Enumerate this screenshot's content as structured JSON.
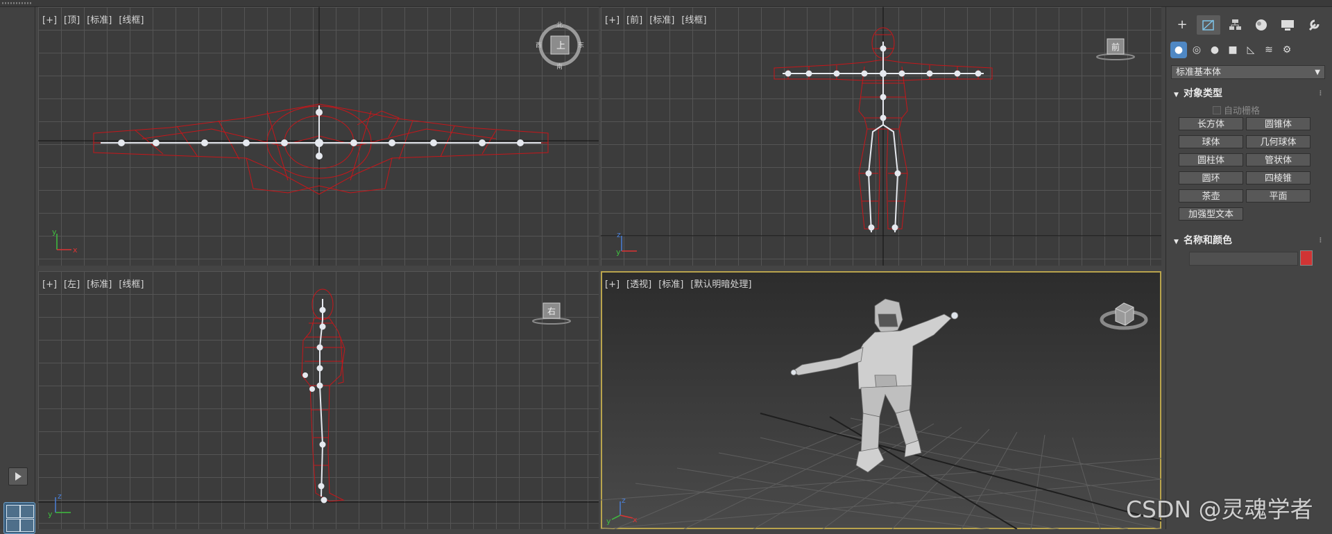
{
  "viewports": {
    "top": {
      "label": [
        "[+]",
        "[顶]",
        "[标准]",
        "[线框]"
      ],
      "gizmo_text": "上",
      "gizmo_dirs": [
        "北",
        "西",
        "东",
        "南"
      ]
    },
    "front": {
      "label": [
        "[+]",
        "[前]",
        "[标准]",
        "[线框]"
      ],
      "gizmo_text": "前"
    },
    "left": {
      "label": [
        "[+]",
        "[左]",
        "[标准]",
        "[线框]"
      ],
      "gizmo_text": "右"
    },
    "persp": {
      "label": [
        "[+]",
        "[透视]",
        "[标准]",
        "[默认明暗处理]"
      ]
    }
  },
  "axes": {
    "x": "x",
    "y": "y",
    "z": "z"
  },
  "command_panel": {
    "tabs": [
      "create-icon",
      "modify-icon",
      "hierarchy-icon",
      "motion-icon",
      "display-icon",
      "utilities-icon"
    ],
    "subtabs": [
      "geometry-icon",
      "shapes-icon",
      "lights-icon",
      "cameras-icon",
      "helpers-icon",
      "spacewarps-icon",
      "systems-icon"
    ],
    "category_dropdown": "标准基本体",
    "object_type": {
      "title": "对象类型",
      "autogrid_label": "自动栅格",
      "buttons": [
        "长方体",
        "圆锥体",
        "球体",
        "几何球体",
        "圆柱体",
        "管状体",
        "圆环",
        "四棱锥",
        "茶壶",
        "平面",
        "加强型文本"
      ]
    },
    "name_color": {
      "title": "名称和颜色",
      "name_value": "",
      "color": "#d03434"
    }
  },
  "colors": {
    "wire": "#c8161a",
    "bone": "#e6e9ef",
    "active_border": "#b9a44d",
    "accent": "#4f88c4"
  },
  "watermark": "CSDN @灵魂学者"
}
